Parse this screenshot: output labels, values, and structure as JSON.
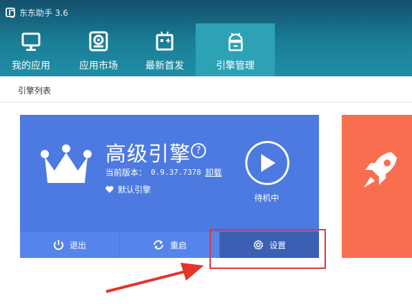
{
  "app": {
    "title": "东东助手 3.6"
  },
  "nav": {
    "items": [
      {
        "label": "我的应用",
        "icon": "monitor-icon"
      },
      {
        "label": "应用市场",
        "icon": "store-icon"
      },
      {
        "label": "最新首发",
        "icon": "robot-box-icon"
      },
      {
        "label": "引擎管理",
        "icon": "android-icon",
        "active": true
      }
    ]
  },
  "subbar": {
    "label": "引擎列表"
  },
  "engine": {
    "title": "高级引擎",
    "version_label": "当前版本：",
    "version": "0.9.37.7378",
    "uninstall_label": "卸载",
    "default_label": "默认引擎",
    "status": "待机中",
    "actions": {
      "exit_label": "退出",
      "restart_label": "重启",
      "settings_label": "设置"
    }
  },
  "colors": {
    "header_top": "#12506b",
    "header_bottom": "#1f8fa6",
    "nav_active": "#2ea2b5",
    "engine_card": "#4c7ae0",
    "settings_bg": "#3a5fb3",
    "second_card": "#fa6e50",
    "highlight": "#e3342c"
  }
}
